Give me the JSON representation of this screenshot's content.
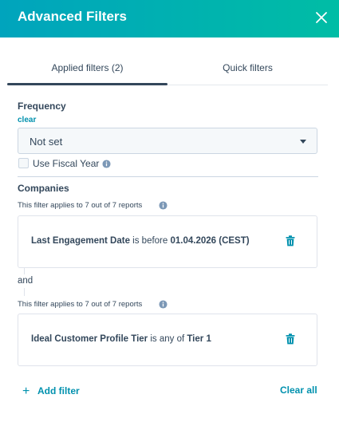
{
  "header": {
    "title": "Advanced Filters"
  },
  "tabs": [
    {
      "label": "Applied filters (2)",
      "active": true
    },
    {
      "label": "Quick filters",
      "active": false
    }
  ],
  "frequency": {
    "label": "Frequency",
    "clear_label": "clear",
    "select_value": "Not set",
    "fiscal_year_label": "Use Fiscal Year",
    "fiscal_year_checked": false
  },
  "companies": {
    "label": "Companies",
    "filters": [
      {
        "note": "This filter applies to 7 out of 7 reports",
        "property": "Last Engagement Date",
        "operator": " is before ",
        "value": "01.04.2026 (CEST)"
      },
      {
        "note": "This filter applies to 7 out of 7 reports",
        "property": "Ideal Customer Profile Tier",
        "operator": " is any of ",
        "value": "Tier 1"
      }
    ],
    "joiner": "and"
  },
  "footer": {
    "add_filter_label": "Add filter",
    "clear_all_label": "Clear all"
  },
  "colors": {
    "header_gradient_start": "#00a4bd",
    "header_gradient_end": "#00bda5",
    "link": "#0091ae",
    "text": "#33475b"
  }
}
